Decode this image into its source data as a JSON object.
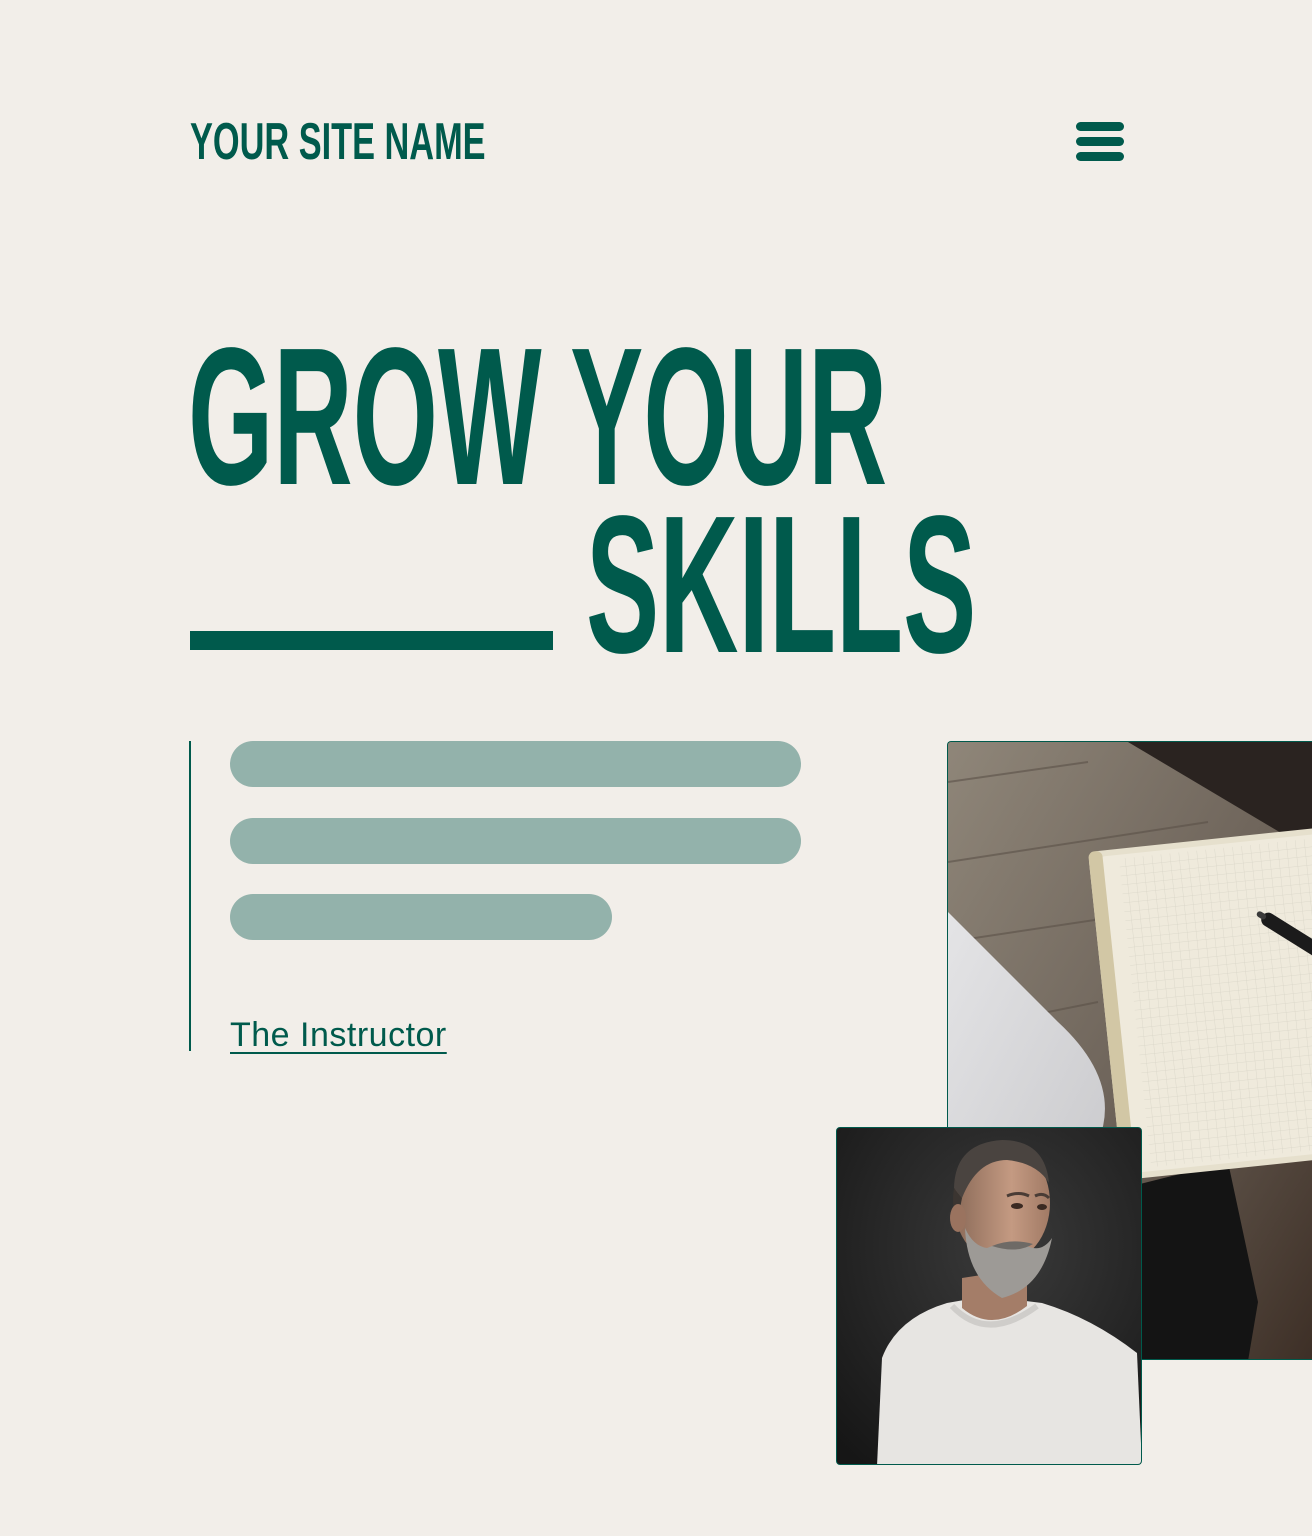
{
  "header": {
    "site_name": "YOUR SITE NAME",
    "menu_icon": "hamburger-menu-icon"
  },
  "hero": {
    "line1": "GROW YOUR",
    "line2": "SKILLS"
  },
  "intro": {
    "instructor_link": "The Instructor"
  },
  "images": {
    "desk": "desk-notebook-laptop-photo",
    "portrait": "bearded-man-portrait-photo"
  },
  "colors": {
    "background": "#f2eee9",
    "accent": "#005a4c",
    "placeholder": "#93b2ab"
  }
}
